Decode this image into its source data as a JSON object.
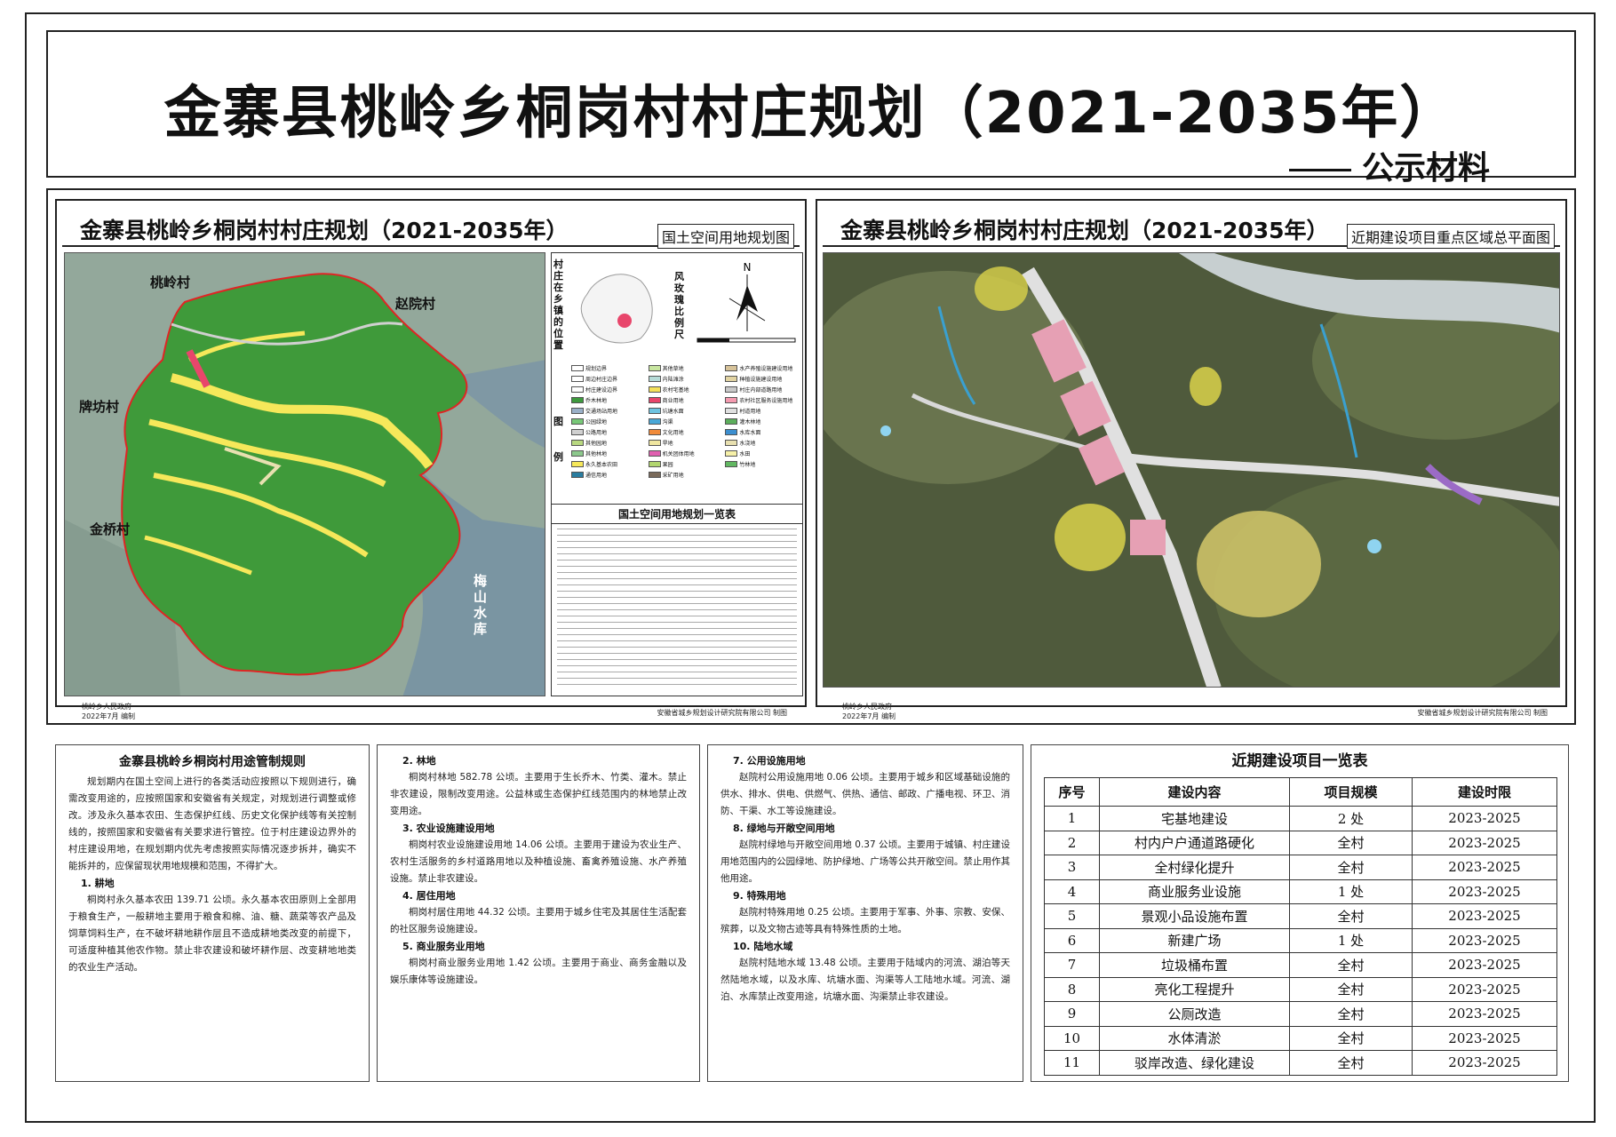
{
  "header": {
    "title": "金寨县桃岭乡桐岗村村庄规划（2021-2035年）",
    "subtitle": "公示材料"
  },
  "left_panel": {
    "title": "金寨县桃岭乡桐岗村村庄规划（2021-2035年）",
    "tag": "国土空间用地规划图",
    "map_labels": {
      "taoling": "桃岭村",
      "zhaoyuan": "赵院村",
      "paifang": "牌坊村",
      "jinqiao": "金桥村",
      "meishan": "梅山水库"
    },
    "location_label": "村庄在乡镇的位置",
    "rose_label": "风玫瑰比例尺",
    "compass": "N",
    "legend_label": "图例",
    "legend_items": [
      {
        "label": "规划边界",
        "color": "#ffffff"
      },
      {
        "label": "其他草地",
        "color": "#c8e6a0"
      },
      {
        "label": "水产养殖设施建设用地",
        "color": "#d7c39a"
      },
      {
        "label": "周边村庄边界",
        "color": "#ffffff"
      },
      {
        "label": "内陆滩涂",
        "color": "#b6dcd8"
      },
      {
        "label": "种植设施建设用地",
        "color": "#e2d4a3"
      },
      {
        "label": "村庄建设边界",
        "color": "#ffffff"
      },
      {
        "label": "农村宅基地",
        "color": "#f4e15a"
      },
      {
        "label": "村庄内部道路用地",
        "color": "#c9c9c9"
      },
      {
        "label": "乔木林地",
        "color": "#3e9a3e"
      },
      {
        "label": "商业用地",
        "color": "#e8466b"
      },
      {
        "label": "农村社区服务设施用地",
        "color": "#f59bb0"
      },
      {
        "label": "交通场站用地",
        "color": "#9ab0c8"
      },
      {
        "label": "坑塘水面",
        "color": "#6ec3e0"
      },
      {
        "label": "村道用地",
        "color": "#e0e0e0"
      },
      {
        "label": "公园绿地",
        "color": "#78c878"
      },
      {
        "label": "沟渠",
        "color": "#4aa8d8"
      },
      {
        "label": "灌木林地",
        "color": "#5cae5c"
      },
      {
        "label": "公路用地",
        "color": "#d0d0d0"
      },
      {
        "label": "文化用地",
        "color": "#f08a3a"
      },
      {
        "label": "水库水面",
        "color": "#3c8fd0"
      },
      {
        "label": "其他园地",
        "color": "#b8d880"
      },
      {
        "label": "旱地",
        "color": "#f0e6a0"
      },
      {
        "label": "水浇地",
        "color": "#e8e0b0"
      },
      {
        "label": "其他林地",
        "color": "#8cc88c"
      },
      {
        "label": "机关团体用地",
        "color": "#e060b0"
      },
      {
        "label": "水田",
        "color": "#f6f0a8"
      },
      {
        "label": "永久基本农田",
        "color": "#f6e85a"
      },
      {
        "label": "果园",
        "color": "#b2d66e"
      },
      {
        "label": "竹林地",
        "color": "#62b862"
      },
      {
        "label": "通信用地",
        "color": "#2a7da0"
      },
      {
        "label": "采矿用地",
        "color": "#7a6a5a"
      }
    ],
    "table_title": "国土空间用地规划一览表",
    "footer_left": "桃岭乡人民政府\n2022年7月 编制",
    "footer_right": "安徽省城乡规划设计研究院有限公司 制图"
  },
  "right_panel": {
    "title": "金寨县桃岭乡桐岗村村庄规划（2021-2035年）",
    "tag": "近期建设项目重点区域总平面图",
    "footer_left": "桃岭乡人民政府\n2022年7月 编制",
    "footer_right": "安徽省城乡规划设计研究院有限公司 制图"
  },
  "rules": {
    "title": "金寨县桃岭乡桐岗村用途管制规则",
    "intro": "规划期内在国土空间上进行的各类活动应按照以下规则进行，确需改变用途的，应按照国家和安徽省有关规定，对规划进行调整或修改。涉及永久基本农田、生态保护红线、历史文化保护线等有关控制线的，按照国家和安徽省有关要求进行管控。位于村庄建设边界外的村庄建设用地，在规划期内优先考虑按照实际情况逐步拆并，确实不能拆并的，应保留现状用地规模和范围，不得扩大。",
    "s1_title": "1. 耕地",
    "s1_text": "桐岗村永久基本农田 139.71 公顷。永久基本农田原则上全部用于粮食生产，一般耕地主要用于粮食和棉、油、糖、蔬菜等农产品及饲草饲料生产，在不破坏耕地耕作层且不造成耕地类改变的前提下，可适度种植其他农作物。禁止非农建设和破坏耕作层、改变耕地地类的农业生产活动。",
    "s2_title": "2. 林地",
    "s2_text": "桐岗村林地 582.78 公顷。主要用于生长乔木、竹类、灌木。禁止非农建设，限制改变用途。公益林或生态保护红线范围内的林地禁止改变用途。",
    "s3_title": "3. 农业设施建设用地",
    "s3_text": "桐岗村农业设施建设用地 14.06 公顷。主要用于建设为农业生产、农村生活服务的乡村道路用地以及种植设施、畜禽养殖设施、水产养殖设施。禁止非农建设。",
    "s4_title": "4. 居住用地",
    "s4_text": "桐岗村居住用地 44.32 公顷。主要用于城乡住宅及其居住生活配套的社区服务设施建设。",
    "s5_title": "5. 商业服务业用地",
    "s5_text": "桐岗村商业服务业用地 1.42 公顷。主要用于商业、商务金融以及娱乐康体等设施建设。",
    "s7_title": "7. 公用设施用地",
    "s7_text": "赵院村公用设施用地 0.06 公顷。主要用于城乡和区域基础设施的供水、排水、供电、供燃气、供热、通信、邮政、广播电视、环卫、消防、干渠、水工等设施建设。",
    "s8_title": "8. 绿地与开敞空间用地",
    "s8_text": "赵院村绿地与开敞空间用地 0.37 公顷。主要用于城镇、村庄建设用地范围内的公园绿地、防护绿地、广场等公共开敞空间。禁止用作其他用途。",
    "s9_title": "9. 特殊用地",
    "s9_text": "赵院村特殊用地 0.25 公顷。主要用于军事、外事、宗教、安保、殡葬，以及文物古迹等具有特殊性质的土地。",
    "s10_title": "10. 陆地水域",
    "s10_text": "赵院村陆地水域 13.48 公顷。主要用于陆域内的河流、湖泊等天然陆地水域，以及水库、坑塘水面、沟渠等人工陆地水域。河流、湖泊、水库禁止改变用途，坑塘水面、沟渠禁止非农建设。"
  },
  "projects": {
    "title": "近期建设项目一览表",
    "headers": [
      "序号",
      "建设内容",
      "项目规模",
      "建设时限"
    ],
    "rows": [
      [
        "1",
        "宅基地建设",
        "2 处",
        "2023-2025"
      ],
      [
        "2",
        "村内户户通道路硬化",
        "全村",
        "2023-2025"
      ],
      [
        "3",
        "全村绿化提升",
        "全村",
        "2023-2025"
      ],
      [
        "4",
        "商业服务业设施",
        "1 处",
        "2023-2025"
      ],
      [
        "5",
        "景观小品设施布置",
        "全村",
        "2023-2025"
      ],
      [
        "6",
        "新建广场",
        "1 处",
        "2023-2025"
      ],
      [
        "7",
        "垃圾桶布置",
        "全村",
        "2023-2025"
      ],
      [
        "8",
        "亮化工程提升",
        "全村",
        "2023-2025"
      ],
      [
        "9",
        "公厕改造",
        "全村",
        "2023-2025"
      ],
      [
        "10",
        "水体清淤",
        "全村",
        "2023-2025"
      ],
      [
        "11",
        "驳岸改造、绿化建设",
        "全村",
        "2023-2025"
      ]
    ]
  }
}
